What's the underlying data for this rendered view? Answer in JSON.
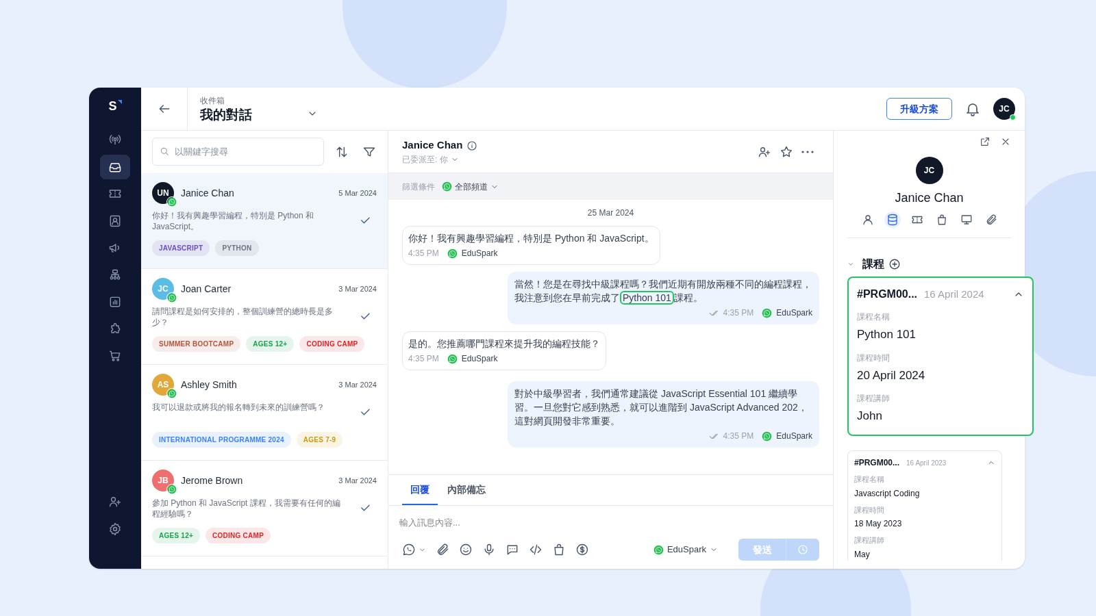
{
  "app": {
    "logo": "S"
  },
  "sidebar": {
    "items": [
      {
        "selected": false
      },
      {
        "selected": true
      },
      {
        "selected": false
      },
      {
        "selected": false
      },
      {
        "selected": false
      },
      {
        "selected": false
      },
      {
        "selected": false
      },
      {
        "selected": false
      },
      {
        "selected": false
      }
    ]
  },
  "header": {
    "breadcrumb": "收件箱",
    "title": "我的對話",
    "upgrade_button": "升級方案",
    "user": {
      "initials": "JC",
      "online": true
    }
  },
  "conversation_list": {
    "search_placeholder": "以關鍵字搜尋",
    "conversations": [
      {
        "initials": "UN",
        "color": "#111827",
        "name": "Janice Chan",
        "date": "5 Mar 2024",
        "preview": "你好！我有興趣學習編程，特別是 Python 和 JavaScript。",
        "selected": true,
        "tags": [
          {
            "label": "JAVASCRIPT",
            "color": "#6b4fbb"
          },
          {
            "label": "PYTHON",
            "color": "#6b7280"
          }
        ]
      },
      {
        "initials": "JC",
        "color": "#5bbde6",
        "name": "Joan Carter",
        "date": "3 Mar 2024",
        "preview": "請問課程是如何安排的，整個訓練營的總時長是多少？",
        "selected": false,
        "tags": [
          {
            "label": "SUMMER BOOTCAMP",
            "color": "#b4553a"
          },
          {
            "label": "AGES 12+",
            "color": "#16a34a"
          },
          {
            "label": "CODING CAMP",
            "color": "#dc2626"
          }
        ]
      },
      {
        "initials": "AS",
        "color": "#e0a83a",
        "name": "Ashley Smith",
        "date": "3 Mar 2024",
        "preview": "我可以退款或將我的報名轉到未來的訓練營嗎？",
        "selected": false,
        "tags": [
          {
            "label": "INTERNATIONAL PROGRAMME 2024",
            "color": "#3b82f6"
          },
          {
            "label": "AGES 7-9",
            "color": "#c99a0c"
          }
        ]
      },
      {
        "initials": "JB",
        "color": "#ef6f6f",
        "name": "Jerome Brown",
        "date": "3 Mar 2024",
        "preview": "參加 Python 和 JavaScript 課程，我需要有任何的編程經驗嗎？",
        "selected": false,
        "tags": [
          {
            "label": "AGES 12+",
            "color": "#16a34a"
          },
          {
            "label": "CODING CAMP",
            "color": "#dc2626"
          }
        ]
      }
    ]
  },
  "chat": {
    "contact_name": "Janice Chan",
    "assigned": "已委派至: 你",
    "filter_label": "篩選條件",
    "channel_filter": "全部頻道",
    "date": "25 Mar 2024",
    "messages": [
      {
        "kind": "incoming",
        "parts": [
          {
            "text": "你好！我有興趣學習編程，特別是 Python 和 JavaScript。",
            "highlighted": false
          }
        ],
        "time": "4:35 PM",
        "channel": "EduSpark"
      },
      {
        "kind": "outgoing",
        "parts": [
          {
            "text": "當然！您是在尋找中級課程嗎？我們近期有開放兩種不同的編程課程，我注意到您在早前完成了",
            "highlighted": false
          },
          {
            "text": "Python 101",
            "highlighted": true
          },
          {
            "text": "課程。",
            "highlighted": false
          }
        ],
        "time": "4:35 PM",
        "channel": "EduSpark"
      },
      {
        "kind": "incoming",
        "parts": [
          {
            "text": "是的。您推薦哪門課程來提升我的編程技能？",
            "highlighted": false
          }
        ],
        "time": "4:35 PM",
        "channel": "EduSpark"
      },
      {
        "kind": "outgoing",
        "parts": [
          {
            "text": "對於中級學習者，我們通常建議從 JavaScript Essential 101 繼續學習。一旦您對它感到熟悉，就可以進階到 JavaScript Advanced 202，這對網頁開發非常重要。",
            "highlighted": false
          }
        ],
        "time": "4:35 PM",
        "channel": "EduSpark"
      }
    ],
    "composer": {
      "tabs": [
        {
          "label": "回覆",
          "selected": true
        },
        {
          "label": "內部備忘",
          "selected": false
        }
      ],
      "placeholder": "輸入訊息內容...",
      "channel": "EduSpark",
      "send_button": "發送",
      "send_disabled": true
    }
  },
  "contact_panel": {
    "initials": "JC",
    "name": "Janice Chan",
    "tabs": [
      {
        "selected": false
      },
      {
        "selected": true
      },
      {
        "selected": false
      },
      {
        "selected": false
      },
      {
        "selected": false
      },
      {
        "selected": false
      }
    ],
    "section_title": "課程",
    "courses": [
      {
        "id": "#PRGM00...",
        "date": "16 April 2024",
        "expanded": true,
        "fields": [
          {
            "label": "課程名稱",
            "value": "Python 101"
          },
          {
            "label": "課程時間",
            "value": "20 April 2024"
          },
          {
            "label": "課程講師",
            "value": "John"
          }
        ]
      },
      {
        "id": "#PRGM00...",
        "date": "16 April 2023",
        "expanded": true,
        "fields": [
          {
            "label": "課程名稱",
            "value": "Javascript Coding"
          },
          {
            "label": "課程時間",
            "value": "18 May 2023"
          },
          {
            "label": "課程講師",
            "value": "May"
          }
        ]
      }
    ]
  }
}
